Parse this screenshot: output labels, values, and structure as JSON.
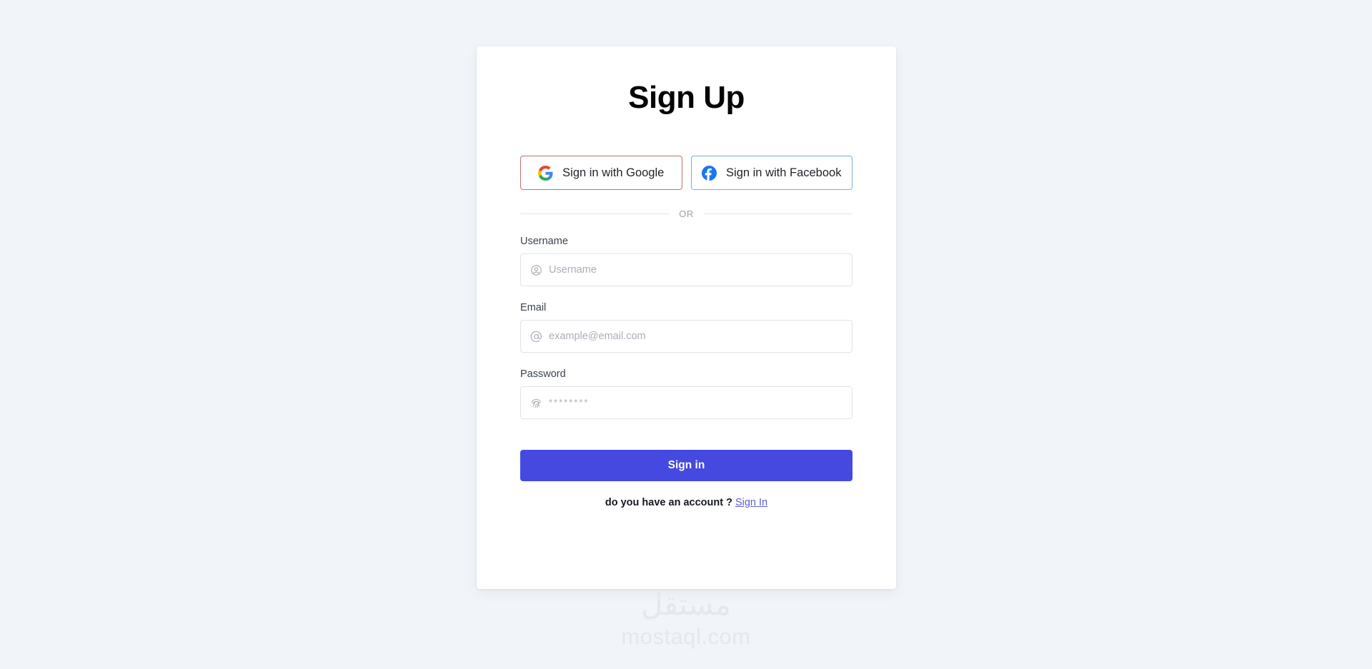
{
  "card": {
    "title": "Sign Up",
    "social": [
      {
        "label": "Sign in with Google",
        "icon": "google-icon",
        "border_color": "#c4706f"
      },
      {
        "label": "Sign in with Facebook",
        "icon": "facebook-icon",
        "border_color": "#72b6c9"
      }
    ],
    "divider_text": "OR",
    "fields": [
      {
        "label": "Username",
        "placeholder": "Username",
        "value": "",
        "icon": "user-circle-icon",
        "type": "text"
      },
      {
        "label": "Email",
        "placeholder": "example@email.com",
        "value": "",
        "icon": "at-sign-icon",
        "type": "text"
      },
      {
        "label": "Password",
        "placeholder": "********",
        "value": "",
        "icon": "fingerprint-icon",
        "type": "password"
      }
    ],
    "submit_label": "Sign in",
    "footer_text": "do you have an account ?",
    "footer_link": "Sign In"
  },
  "watermark": {
    "arabic": "مستقل",
    "domain": "mostaql.com"
  },
  "colors": {
    "page_background": "#f1f4f8",
    "card_background": "#ffffff",
    "primary": "#4549e0",
    "link": "#5b5fd6",
    "text": "#14181f",
    "muted": "#a9afb8",
    "border": "#dfe3e8",
    "watermark": "#e4e8ee"
  }
}
